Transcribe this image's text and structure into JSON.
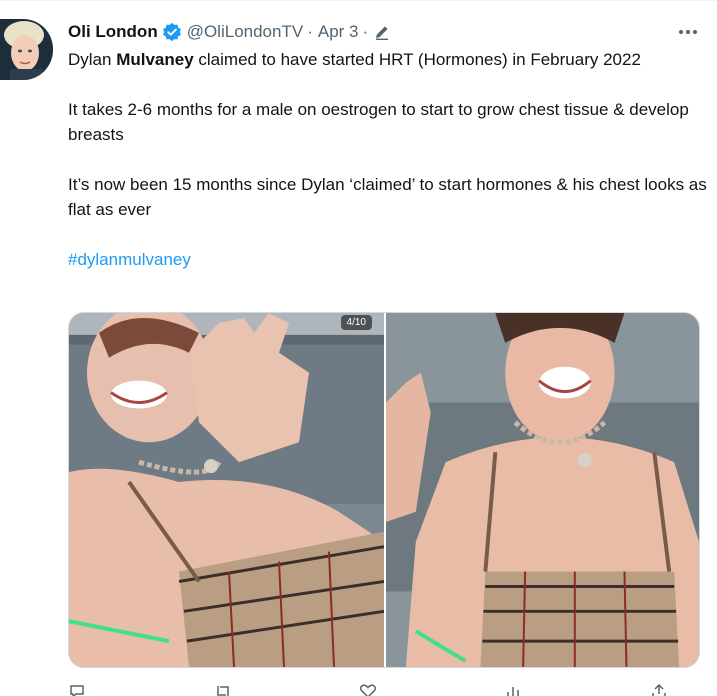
{
  "tweet": {
    "author_name": "Oli London",
    "author_handle": "@OliLondonTV",
    "separator": "·",
    "timestamp": "Apr 3",
    "separator2": "·",
    "more_label": "•••",
    "verified_color": "#1d9bf0",
    "body": {
      "line1_pre": "Dylan ",
      "line1_bold": "Mulvaney",
      "line1_post": " claimed to have started HRT (Hormones) in February 2022",
      "paragraph2": "It takes 2-6 months for a male on oestrogen to start to grow chest tissue & develop breasts",
      "paragraph3": "It’s now been 15 months since Dylan ‘claimed’ to start hormones & his chest looks as flat as ever",
      "hashtag": "#dylanmulvaney"
    },
    "media": {
      "counter": "4/10",
      "left_photo": "person-waving-photo",
      "right_photo": "person-smiling-photo"
    }
  },
  "icons": {
    "verified": "verified-badge-icon",
    "edit": "edit-pencil-icon",
    "more": "more-options-icon",
    "reply": "reply-icon",
    "retweet": "retweet-icon",
    "like": "like-icon",
    "views": "views-icon",
    "share": "share-icon"
  }
}
